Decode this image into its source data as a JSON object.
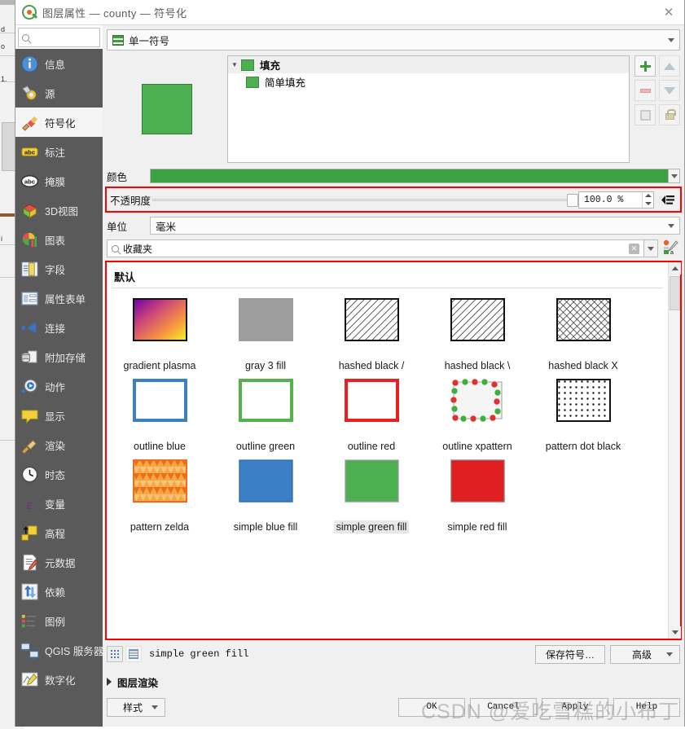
{
  "window": {
    "title": "图层属性 — county — 符号化",
    "close_label": "✕",
    "logo_icon": "qgis-logo-icon"
  },
  "sidebar": {
    "search_placeholder": "",
    "search_value": "",
    "search_icon": "search-icon",
    "items": [
      {
        "label": "信息",
        "icon": "info-icon",
        "selected": false
      },
      {
        "label": "源",
        "icon": "source-icon",
        "selected": false
      },
      {
        "label": "符号化",
        "icon": "symbology-icon",
        "selected": true
      },
      {
        "label": "标注",
        "icon": "labels-icon",
        "selected": false
      },
      {
        "label": "掩膜",
        "icon": "masks-icon",
        "selected": false
      },
      {
        "label": "3D视图",
        "icon": "3dview-icon",
        "selected": false
      },
      {
        "label": "图表",
        "icon": "diagrams-icon",
        "selected": false
      },
      {
        "label": "字段",
        "icon": "fields-icon",
        "selected": false
      },
      {
        "label": "属性表单",
        "icon": "attributes-form-icon",
        "selected": false
      },
      {
        "label": "连接",
        "icon": "joins-icon",
        "selected": false
      },
      {
        "label": "附加存储",
        "icon": "auxiliary-storage-icon",
        "selected": false
      },
      {
        "label": "动作",
        "icon": "actions-icon",
        "selected": false
      },
      {
        "label": "显示",
        "icon": "display-icon",
        "selected": false
      },
      {
        "label": "渲染",
        "icon": "rendering-icon",
        "selected": false
      },
      {
        "label": "时态",
        "icon": "temporal-icon",
        "selected": false
      },
      {
        "label": "变量",
        "icon": "variables-icon",
        "selected": false
      },
      {
        "label": "高程",
        "icon": "elevation-icon",
        "selected": false
      },
      {
        "label": "元数据",
        "icon": "metadata-icon",
        "selected": false
      },
      {
        "label": "依赖",
        "icon": "dependencies-icon",
        "selected": false
      },
      {
        "label": "图例",
        "icon": "legend-icon",
        "selected": false
      },
      {
        "label": "QGIS 服务器",
        "icon": "qgis-server-icon",
        "selected": false
      },
      {
        "label": "数字化",
        "icon": "digitizing-icon",
        "selected": false
      }
    ]
  },
  "renderer": {
    "label": "单一符号",
    "icon": "single-symbol-icon",
    "dropdown_icon": "chevron-down-icon"
  },
  "symbol_tree": {
    "preview_color": "#4caf50",
    "rows": [
      {
        "label": "填充",
        "swatch": "#4caf50",
        "level": 0,
        "expander": "▼"
      },
      {
        "label": "简单填充",
        "swatch": "#4caf50",
        "level": 1,
        "expander": ""
      }
    ],
    "buttons": [
      {
        "name": "add-symbol-layer-button",
        "icon": "plus-icon"
      },
      {
        "name": "move-up-button",
        "icon": "arrow-up-icon"
      },
      {
        "name": "remove-symbol-layer-button",
        "icon": "minus-icon"
      },
      {
        "name": "move-down-button",
        "icon": "arrow-down-icon"
      },
      {
        "name": "duplicate-button",
        "icon": "copy-icon"
      },
      {
        "name": "lock-button",
        "icon": "lock-icon"
      }
    ]
  },
  "properties": {
    "color_label": "颜色",
    "color_value": "#3ba143",
    "opacity_label": "不透明度",
    "opacity_value": "100.0 %",
    "opacity_percent": 100,
    "unit_label": "单位",
    "unit_value": "毫米"
  },
  "symbol_search": {
    "value": "收藏夹",
    "search_icon": "search-icon",
    "clear_icon": "clear-icon",
    "dropdown_icon": "chevron-down-icon",
    "style_manager_icon": "style-manager-icon"
  },
  "gallery": {
    "group_title": "默认",
    "selected": "simple green fill",
    "symbols": [
      {
        "name": "gradient  plasma",
        "kind": "gradient-plasma"
      },
      {
        "name": "gray 3 fill",
        "kind": "gray-fill"
      },
      {
        "name": "hashed black /",
        "kind": "hatch-fwd"
      },
      {
        "name": "hashed black \\",
        "kind": "hatch-fwd2"
      },
      {
        "name": "hashed black X",
        "kind": "hatch-cross"
      },
      {
        "name": "outline blue",
        "kind": "outline-blue"
      },
      {
        "name": "outline green",
        "kind": "outline-green"
      },
      {
        "name": "outline red",
        "kind": "outline-red"
      },
      {
        "name": "outline xpattern",
        "kind": "outline-xpattern"
      },
      {
        "name": "pattern dot black",
        "kind": "dot-black"
      },
      {
        "name": "pattern zelda",
        "kind": "zelda"
      },
      {
        "name": "simple blue fill",
        "kind": "fill-blue"
      },
      {
        "name": "simple green fill",
        "kind": "fill-green"
      },
      {
        "name": "simple red fill",
        "kind": "fill-red"
      }
    ]
  },
  "bottom_toolbar": {
    "current_symbol": "simple green fill",
    "grid_view_icon": "grid-view-icon",
    "list_view_icon": "list-view-icon",
    "save_symbol_label": "保存符号…",
    "advanced_label": "高级",
    "advanced_dropdown_icon": "chevron-down-icon"
  },
  "layer_rendering": {
    "label": "图层渲染",
    "expander_icon": "triangle-right-icon"
  },
  "footer": {
    "style_label": "样式",
    "style_dropdown_icon": "chevron-down-icon",
    "ok_label": "OK",
    "cancel_label": "Cancel",
    "apply_label": "Apply",
    "help_label": "Help"
  },
  "watermark": {
    "text": "CSDN @爱吃雪糕的小布丁"
  },
  "colors": {
    "highlight_red": "#ff0000",
    "green_fill": "#4caf50",
    "sidebar_bg": "#5a5a5a",
    "selected_nav": "#f5f5f5"
  },
  "background_window": {
    "fragments": [
      "d",
      "o",
      "1.",
      "i"
    ]
  }
}
